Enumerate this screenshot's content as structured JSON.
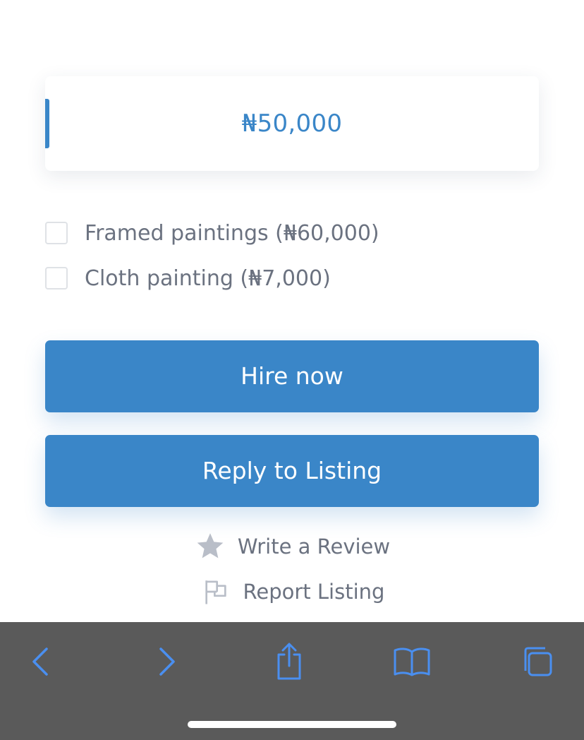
{
  "price": {
    "value": "₦50,000"
  },
  "options": [
    {
      "label": "Framed paintings (₦60,000)",
      "checked": false
    },
    {
      "label": "Cloth painting (₦7,000)",
      "checked": false
    }
  ],
  "actions": {
    "hire_label": "Hire now",
    "reply_label": "Reply to Listing"
  },
  "links": {
    "review_label": "Write a Review",
    "report_label": "Report Listing"
  },
  "icons": {
    "review": "star-icon",
    "report": "flag-icon",
    "toolbar": [
      "chevron-left-icon",
      "chevron-right-icon",
      "share-icon",
      "book-icon",
      "tabs-icon"
    ]
  },
  "colors": {
    "accent": "#3a86c8",
    "text_muted": "#6b7280",
    "toolbar_bg": "#5a5a5a",
    "toolbar_icon": "#4a8ff0",
    "icon_muted": "#b9bec8"
  }
}
